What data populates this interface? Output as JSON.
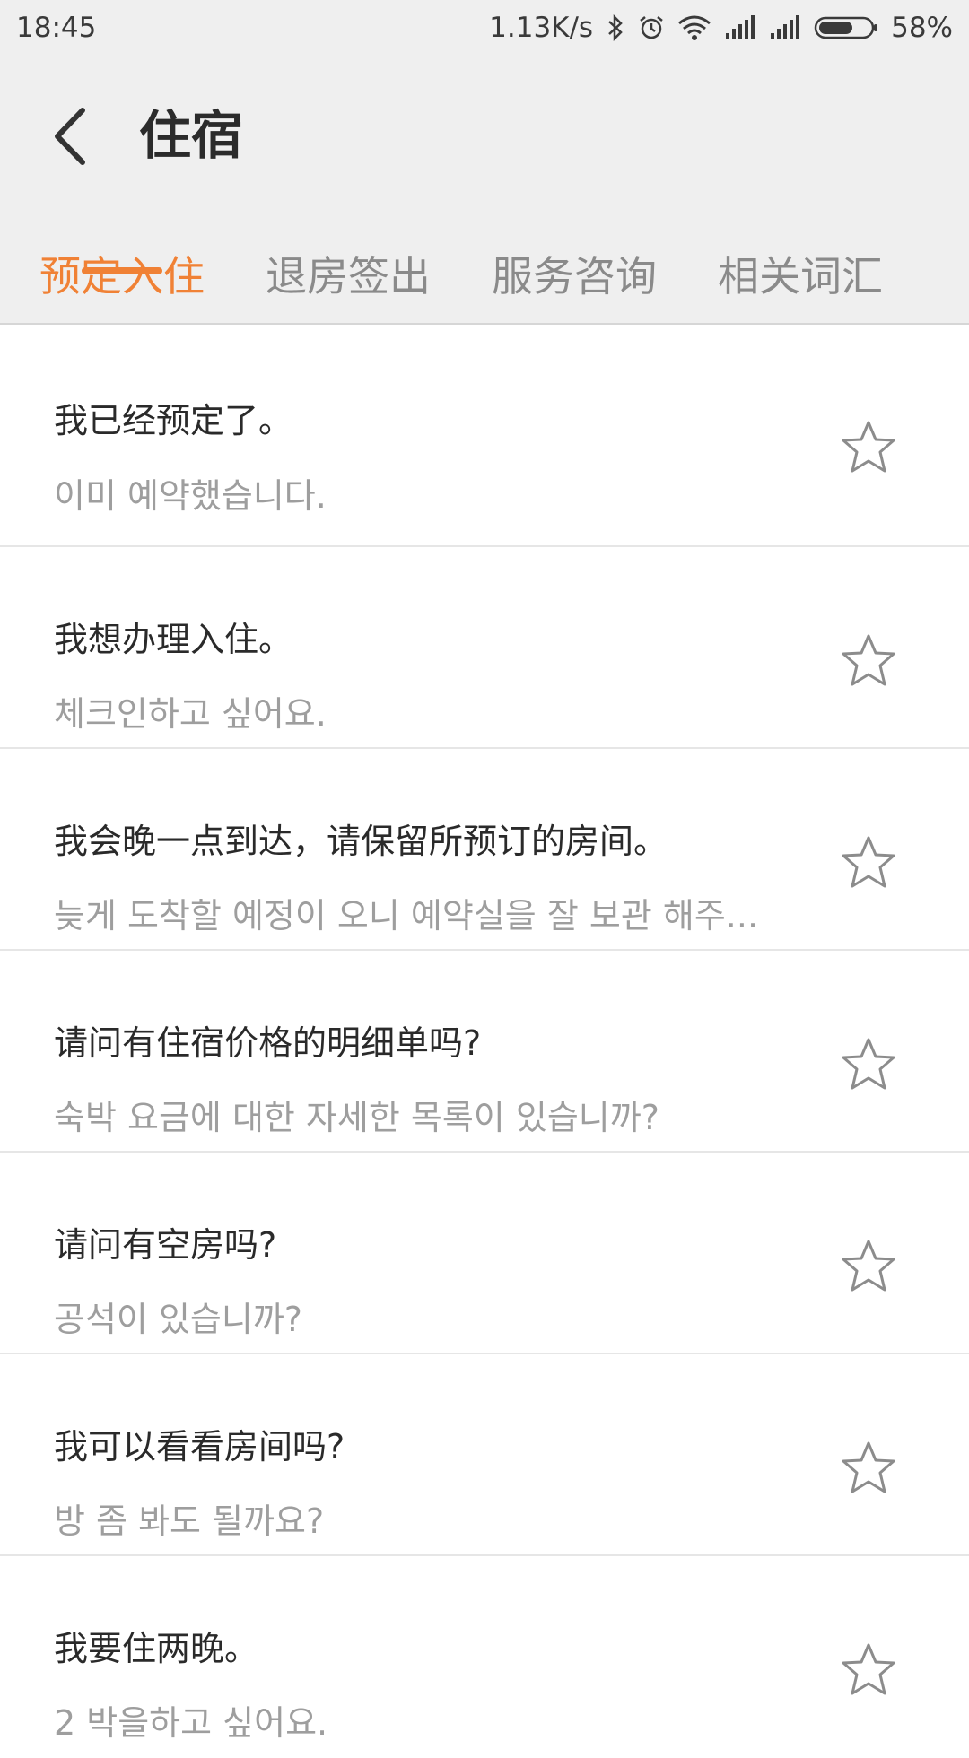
{
  "status_bar": {
    "time": "18:45",
    "network_speed": "1.13K/s",
    "battery": "58%",
    "icons": [
      "bluetooth-icon",
      "alarm-icon",
      "wifi-icon",
      "signal-icon",
      "signal-icon",
      "battery-icon"
    ]
  },
  "header": {
    "title": "住宿",
    "back_icon": "chevron-left-icon"
  },
  "tabs": [
    {
      "label": "预定入住",
      "active": true
    },
    {
      "label": "退房签出",
      "active": false
    },
    {
      "label": "服务咨询",
      "active": false
    },
    {
      "label": "相关词汇",
      "active": false
    }
  ],
  "colors": {
    "accent": "#f08135",
    "header_bg": "#efefef",
    "primary_text": "#2a2a2a",
    "secondary_text": "#9e9e9e"
  },
  "phrases": [
    {
      "zh": "我已经预定了。",
      "ko": "이미 예약했습니다."
    },
    {
      "zh": "我想办理入住。",
      "ko": "체크인하고 싶어요."
    },
    {
      "zh": "我会晚一点到达，请保留所预订的房间。",
      "ko": "늦게 도착할 예정이 오니 예약실을 잘 보관 해주..."
    },
    {
      "zh": "请问有住宿价格的明细单吗?",
      "ko": "숙박 요금에 대한 자세한 목록이 있습니까?"
    },
    {
      "zh": "请问有空房吗?",
      "ko": "공석이 있습니까?"
    },
    {
      "zh": "我可以看看房间吗?",
      "ko": "방 좀 봐도 될까요?"
    },
    {
      "zh": "我要住两晚。",
      "ko": "2 박을하고 싶어요."
    }
  ]
}
